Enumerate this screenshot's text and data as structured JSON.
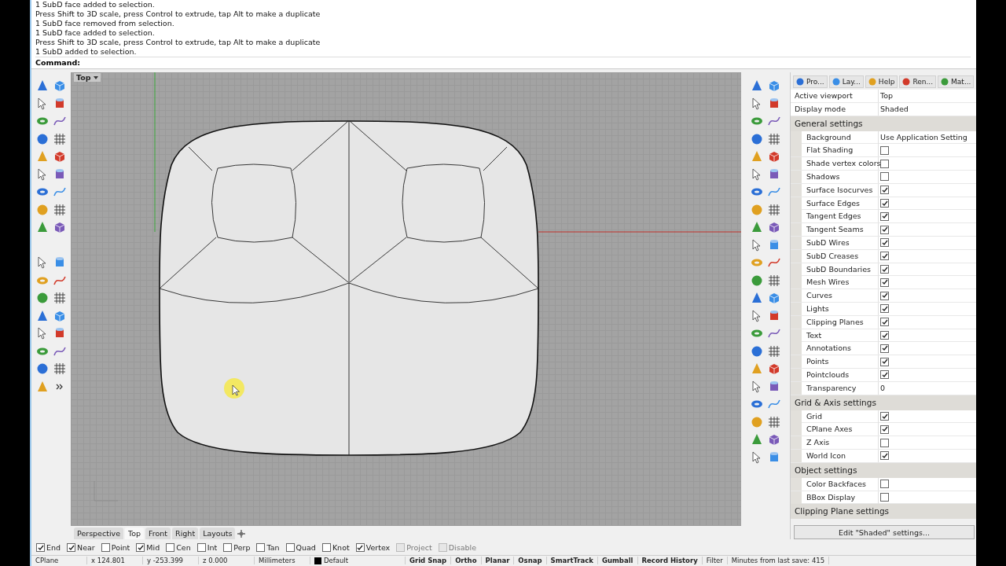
{
  "command_history": [
    "1 SubD face added to selection.",
    "Press Shift to 3D scale, press Control to extrude, tap Alt to make a duplicate",
    "1 SubD face removed from selection.",
    "1 SubD face added to selection.",
    "Press Shift to 3D scale, press Control to extrude, tap Alt to make a duplicate",
    "1 SubD added to selection."
  ],
  "command_prompt": "Command:",
  "viewport": {
    "title": "Top",
    "tabs": [
      {
        "label": "Perspective",
        "selected": false
      },
      {
        "label": "Top",
        "selected": true
      },
      {
        "label": "Front",
        "selected": false
      },
      {
        "label": "Right",
        "selected": false
      },
      {
        "label": "Layouts",
        "selected": false
      }
    ]
  },
  "panel": {
    "tabs": [
      {
        "label": "Pro...",
        "selected": false
      },
      {
        "label": "Lay...",
        "selected": false
      },
      {
        "label": "Help",
        "selected": false
      },
      {
        "label": "Ren...",
        "selected": false
      },
      {
        "label": "Mat...",
        "selected": false
      }
    ],
    "header_rows": [
      {
        "label": "Active viewport",
        "value": "Top"
      },
      {
        "label": "Display mode",
        "value": "Shaded"
      }
    ],
    "sections": [
      {
        "title": "General settings",
        "rows": [
          {
            "label": "Background",
            "kind": "text",
            "value": "Use Application Setting"
          },
          {
            "label": "Flat Shading",
            "kind": "checkbox",
            "checked": false
          },
          {
            "label": "Shade vertex colors",
            "kind": "checkbox",
            "checked": false
          },
          {
            "label": "Shadows",
            "kind": "checkbox",
            "checked": false
          },
          {
            "label": "Surface Isocurves",
            "kind": "checkbox",
            "checked": true
          },
          {
            "label": "Surface Edges",
            "kind": "checkbox",
            "checked": true
          },
          {
            "label": "Tangent Edges",
            "kind": "checkbox",
            "checked": true
          },
          {
            "label": "Tangent Seams",
            "kind": "checkbox",
            "checked": true
          },
          {
            "label": "SubD Wires",
            "kind": "checkbox",
            "checked": true
          },
          {
            "label": "SubD Creases",
            "kind": "checkbox",
            "checked": true
          },
          {
            "label": "SubD Boundaries",
            "kind": "checkbox",
            "checked": true
          },
          {
            "label": "Mesh Wires",
            "kind": "checkbox",
            "checked": true
          },
          {
            "label": "Curves",
            "kind": "checkbox",
            "checked": true
          },
          {
            "label": "Lights",
            "kind": "checkbox",
            "checked": true
          },
          {
            "label": "Clipping Planes",
            "kind": "checkbox",
            "checked": true
          },
          {
            "label": "Text",
            "kind": "checkbox",
            "checked": true
          },
          {
            "label": "Annotations",
            "kind": "checkbox",
            "checked": true
          },
          {
            "label": "Points",
            "kind": "checkbox",
            "checked": true
          },
          {
            "label": "Pointclouds",
            "kind": "checkbox",
            "checked": true
          },
          {
            "label": "Transparency",
            "kind": "text",
            "value": "0"
          }
        ]
      },
      {
        "title": "Grid & Axis settings",
        "rows": [
          {
            "label": "Grid",
            "kind": "checkbox",
            "checked": true
          },
          {
            "label": "CPlane Axes",
            "kind": "checkbox",
            "checked": true
          },
          {
            "label": "Z Axis",
            "kind": "checkbox",
            "checked": false
          },
          {
            "label": "World Icon",
            "kind": "checkbox",
            "checked": true
          }
        ]
      },
      {
        "title": "Object settings",
        "rows": [
          {
            "label": "Color Backfaces",
            "kind": "checkbox",
            "checked": false
          },
          {
            "label": "BBox Display",
            "kind": "checkbox",
            "checked": false
          }
        ]
      },
      {
        "title": "Clipping Plane settings"
      }
    ],
    "button": "Edit \"Shaded\" settings..."
  },
  "osnaps": [
    {
      "label": "End",
      "checked": true,
      "disabled": false
    },
    {
      "label": "Near",
      "checked": true,
      "disabled": false
    },
    {
      "label": "Point",
      "checked": false,
      "disabled": false
    },
    {
      "label": "Mid",
      "checked": true,
      "disabled": false
    },
    {
      "label": "Cen",
      "checked": false,
      "disabled": false
    },
    {
      "label": "Int",
      "checked": false,
      "disabled": false
    },
    {
      "label": "Perp",
      "checked": false,
      "disabled": false
    },
    {
      "label": "Tan",
      "checked": false,
      "disabled": false
    },
    {
      "label": "Quad",
      "checked": false,
      "disabled": false
    },
    {
      "label": "Knot",
      "checked": false,
      "disabled": false
    },
    {
      "label": "Vertex",
      "checked": true,
      "disabled": false
    },
    {
      "label": "Project",
      "checked": false,
      "disabled": true
    },
    {
      "label": "Disable",
      "checked": false,
      "disabled": true
    }
  ],
  "status_bar": {
    "cplane": "CPlane",
    "x": "x 124.801",
    "y": "y -253.399",
    "z": "z 0.000",
    "units": "Millimeters",
    "layer": "Default",
    "toggles": [
      {
        "label": "Grid Snap",
        "on": true
      },
      {
        "label": "Ortho",
        "on": true
      },
      {
        "label": "Planar",
        "on": true
      },
      {
        "label": "Osnap",
        "on": true
      },
      {
        "label": "SmartTrack",
        "on": true
      },
      {
        "label": "Gumball",
        "on": true
      },
      {
        "label": "Record History",
        "on": true
      },
      {
        "label": "Filter",
        "on": false
      }
    ],
    "message": "Minutes from last save: 415"
  }
}
